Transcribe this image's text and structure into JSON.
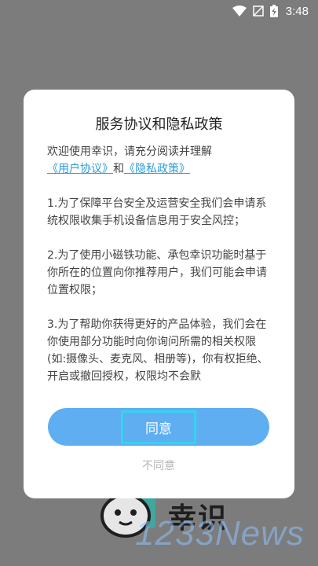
{
  "status_bar": {
    "time": "3:48",
    "icons": [
      "wifi-icon",
      "signal-off-icon",
      "battery-charging-icon"
    ]
  },
  "background": {
    "brand_text": "幸识",
    "watermark": "1233News"
  },
  "dialog": {
    "title": "服务协议和隐私政策",
    "intro_text": "欢迎使用幸识，请充分阅读并理解",
    "user_agreement_link": "《用户协议》",
    "and_text": "和",
    "privacy_policy_link": "《隐私政策》",
    "paragraphs": [
      "1.为了保障平台安全及运营安全我们会申请系统权限收集手机设备信息用于安全风控；",
      "2.为了使用小磁铁功能、承包幸识功能时基于你所在的位置向你推荐用户，我们可能会申请位置权限；",
      "3.为了帮助你获得更好的产品体验，我们会在你使用部分功能时向你询问所需的相关权限 (如:摄像头、麦克风、相册等)，你有权拒绝、开启或撤回授权，权限均不会默"
    ],
    "agree_label": "同意",
    "disagree_label": "不同意"
  },
  "colors": {
    "overlay": "#7c7c7c",
    "accent": "#5faef2",
    "link": "#2e9bd6",
    "focus_outline": "#34d4ee"
  }
}
